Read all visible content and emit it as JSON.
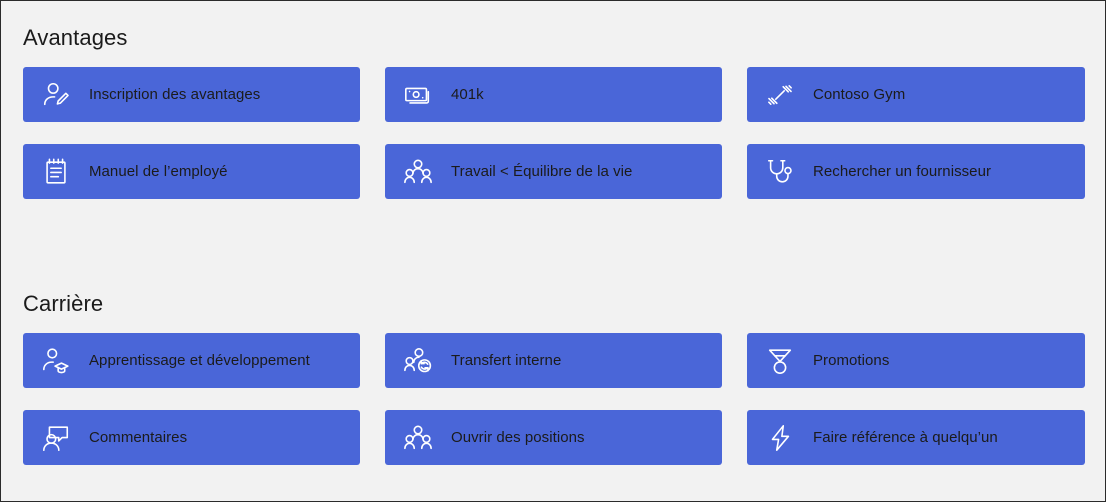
{
  "theme": {
    "page_background": "#f2f2f2",
    "tile_background": "#4a66d8",
    "tile_label_color": "#1b1b1b",
    "section_title_color": "#1b1b1b",
    "icon_color": "#ffffff",
    "border_color": "#2b2b2b"
  },
  "sections": [
    {
      "id": "benefits",
      "title": "Avantages",
      "tiles": [
        {
          "label": "Inscription des avantages",
          "icon": "person-edit-icon"
        },
        {
          "label": "401k",
          "icon": "money-banknote-icon"
        },
        {
          "label": "Contoso Gym",
          "icon": "dumbbell-icon"
        },
        {
          "label": "Manuel de l’employé",
          "icon": "notepad-icon"
        },
        {
          "label": "Travail <  Équilibre de la vie",
          "icon": "people-group-icon"
        },
        {
          "label": "Rechercher un fournisseur",
          "icon": "stethoscope-icon"
        }
      ]
    },
    {
      "id": "career",
      "title": "Carrière",
      "tiles": [
        {
          "label": "Apprentissage et développement",
          "icon": "person-graduation-cap-icon"
        },
        {
          "label": "Transfert interne",
          "icon": "people-sync-icon"
        },
        {
          "label": "Promotions",
          "icon": "medal-icon"
        },
        {
          "label": "Commentaires",
          "icon": "person-comment-icon"
        },
        {
          "label": "Ouvrir des positions",
          "icon": "people-group-icon"
        },
        {
          "label": "Faire référence à quelqu’un",
          "icon": "lightning-bolt-icon"
        }
      ]
    }
  ]
}
